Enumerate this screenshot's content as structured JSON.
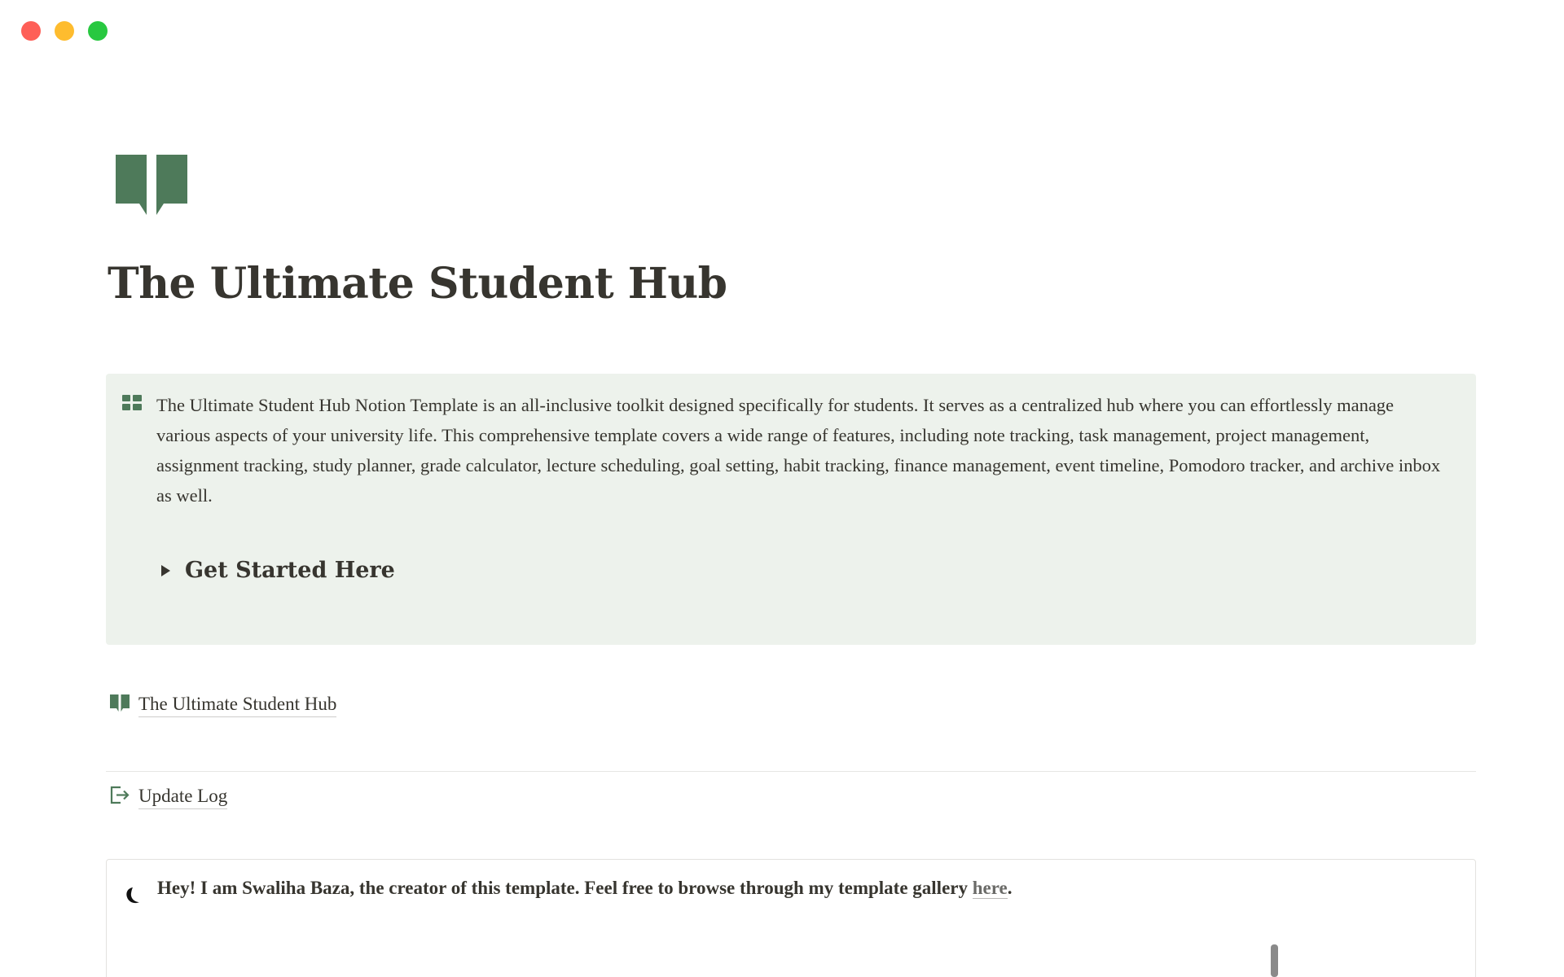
{
  "window": {
    "controls": [
      "close",
      "minimize",
      "maximize"
    ]
  },
  "page": {
    "icon": "open-book-icon",
    "title": "The Ultimate Student Hub"
  },
  "callout": {
    "icon": "grid-icon",
    "text": "The Ultimate Student Hub Notion Template is an all-inclusive toolkit designed specifically for students. It serves as a centralized hub where you can effortlessly manage various aspects of your university life. This comprehensive template covers a wide range of features, including note tracking, task management, project management, assignment tracking, study planner, grade calculator, lecture scheduling,  goal setting, habit tracking, finance management, event timeline, Pomodoro tracker, and archive inbox as well.",
    "toggle_label": "Get Started Here"
  },
  "links": {
    "hub": {
      "icon": "open-book-icon",
      "label": "The Ultimate Student Hub"
    },
    "update_log": {
      "icon": "exit-arrow-icon",
      "label": "Update Log"
    }
  },
  "creator_callout": {
    "icon": "moon-icon",
    "text": "Hey! I am Swaliha Baza, the creator of this template. Feel free to browse through my template gallery ",
    "link_text": "here",
    "suffix": "."
  },
  "colors": {
    "accent_green": "#4e7a5a",
    "callout_bg": "#edf2ec",
    "text": "#37352f"
  }
}
